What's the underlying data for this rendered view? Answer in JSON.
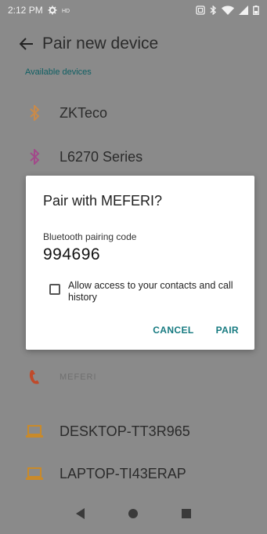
{
  "status_bar": {
    "time": "2:12 PM",
    "left_icons": [
      "gear-icon",
      "hd-icon"
    ],
    "right_icons": [
      "nfc-icon",
      "bluetooth-icon",
      "wifi-icon",
      "signal-icon",
      "battery-icon"
    ]
  },
  "app_bar": {
    "back_icon": "back-arrow-icon",
    "title": "Pair new device"
  },
  "section": {
    "available_label": "Available devices"
  },
  "devices": [
    {
      "label": "ZKTeco",
      "icon": "bluetooth-icon",
      "color": "#c98a4a"
    },
    {
      "label": "L6270 Series",
      "icon": "bluetooth-icon",
      "color": "#a24a8a"
    },
    {
      "label": "MEFERI",
      "icon": "phone-icon",
      "color": "#c04a2a"
    },
    {
      "label": "DESKTOP-TT3R965",
      "icon": "laptop-icon",
      "color": "#c98a2a"
    },
    {
      "label": "LAPTOP-TI43ERAP",
      "icon": "laptop-icon",
      "color": "#c98a2a"
    }
  ],
  "dialog": {
    "title": "Pair with MEFERI?",
    "code_label": "Bluetooth pairing code",
    "code": "994696",
    "checkbox_label": "Allow access to your contacts and call history",
    "checkbox_checked": false,
    "cancel_label": "CANCEL",
    "pair_label": "PAIR",
    "accent_color": "#167a80"
  },
  "nav_bar": {
    "buttons": [
      "back-triangle-icon",
      "home-circle-icon",
      "recents-square-icon"
    ]
  }
}
